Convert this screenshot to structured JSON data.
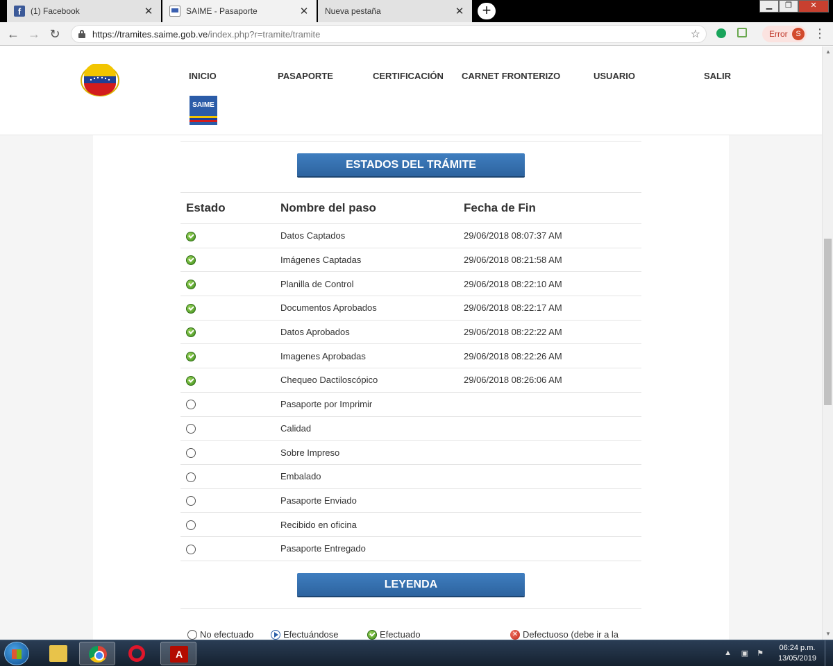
{
  "browser": {
    "tabs": [
      {
        "title": "(1) Facebook",
        "fav": "f"
      },
      {
        "title": "SAIME - Pasaporte",
        "fav": ""
      },
      {
        "title": "Nueva pestaña",
        "fav": ""
      }
    ],
    "url_host": "https://tramites.saime.gob.ve",
    "url_path": "/index.php?r=tramite/tramite",
    "error_label": "Error",
    "avatar_letter": "S"
  },
  "nav": {
    "items": [
      "INICIO",
      "PASAPORTE",
      "CERTIFICACIÓN",
      "CARNET FRONTERIZO",
      "USUARIO",
      "SALIR"
    ],
    "logo_text": "SAIME"
  },
  "tramite": {
    "states_title": "ESTADOS DEL TRÁMITE",
    "columns": [
      "Estado",
      "Nombre del paso",
      "Fecha de Fin"
    ],
    "steps": [
      {
        "name": "Datos Captados",
        "date": "29/06/2018 08:07:37 AM",
        "status": "done"
      },
      {
        "name": "Imágenes Captadas",
        "date": "29/06/2018 08:21:58 AM",
        "status": "done"
      },
      {
        "name": "Planilla de Control",
        "date": "29/06/2018 08:22:10 AM",
        "status": "done"
      },
      {
        "name": "Documentos Aprobados",
        "date": "29/06/2018 08:22:17 AM",
        "status": "done"
      },
      {
        "name": "Datos Aprobados",
        "date": "29/06/2018 08:22:22 AM",
        "status": "done"
      },
      {
        "name": "Imagenes Aprobadas",
        "date": "29/06/2018 08:22:26 AM",
        "status": "done"
      },
      {
        "name": "Chequeo Dactiloscópico",
        "date": "29/06/2018 08:26:06 AM",
        "status": "done"
      },
      {
        "name": "Pasaporte por Imprimir",
        "date": "",
        "status": "pending"
      },
      {
        "name": "Calidad",
        "date": "",
        "status": "pending"
      },
      {
        "name": "Sobre Impreso",
        "date": "",
        "status": "pending"
      },
      {
        "name": "Embalado",
        "date": "",
        "status": "pending"
      },
      {
        "name": "Pasaporte Enviado",
        "date": "",
        "status": "pending"
      },
      {
        "name": "Recibido en oficina",
        "date": "",
        "status": "pending"
      },
      {
        "name": "Pasaporte Entregado",
        "date": "",
        "status": "pending"
      }
    ],
    "legend_title": "LEYENDA",
    "legend": {
      "pending": "No efectuado",
      "progress": "Efectuándose",
      "done": "Efectuado",
      "bad": "Defectuoso (debe ir a la"
    }
  },
  "taskbar": {
    "time": "06:24 p.m.",
    "date": "13/05/2019",
    "pdf_glyph": "A"
  },
  "colors": {
    "accent_button": "#2d639f",
    "done_green": "#3f8f1c",
    "error_red": "#c0281a"
  }
}
